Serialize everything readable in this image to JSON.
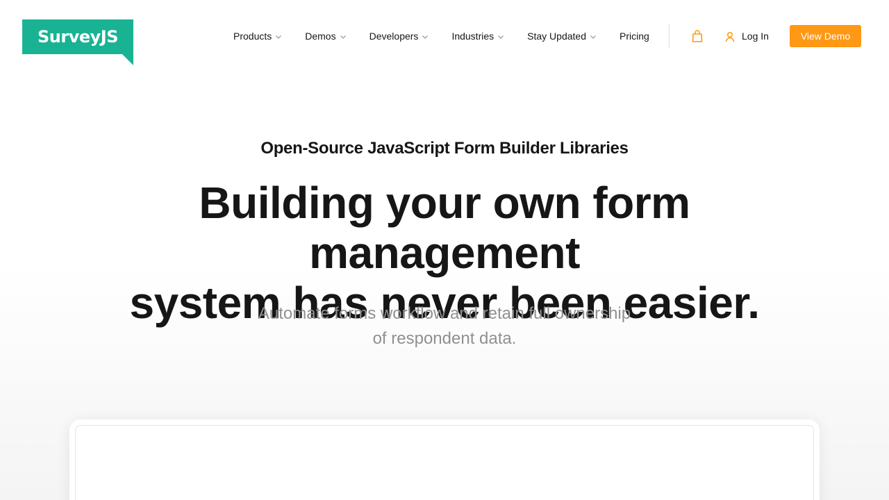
{
  "brand": {
    "name": "SurveyJS",
    "color": "#19b394"
  },
  "nav": {
    "items": [
      {
        "label": "Products",
        "has_dropdown": true
      },
      {
        "label": "Demos",
        "has_dropdown": true
      },
      {
        "label": "Developers",
        "has_dropdown": true
      },
      {
        "label": "Industries",
        "has_dropdown": true
      },
      {
        "label": "Stay Updated",
        "has_dropdown": true
      },
      {
        "label": "Pricing",
        "has_dropdown": false
      }
    ],
    "cart_icon": "shopping-bag-icon",
    "login_label": "Log In",
    "login_icon": "user-icon",
    "cta_label": "View Demo",
    "accent": "#ff9814"
  },
  "hero": {
    "eyebrow": "Open-Source JavaScript Form Builder Libraries",
    "headline_line1": "Building your own form management",
    "headline_line2": "system has never been easier.",
    "sub_line1": "Automate forms workflow and retain full ownership",
    "sub_line2": "of respondent data."
  }
}
